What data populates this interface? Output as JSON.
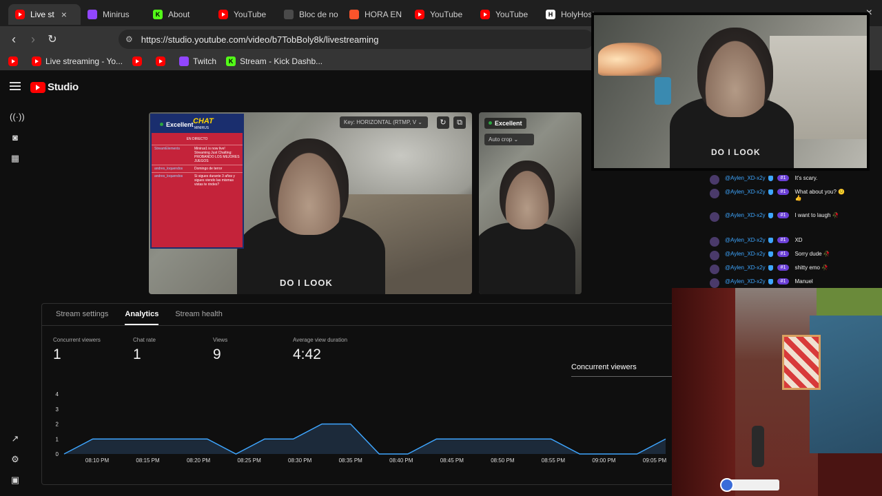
{
  "browser": {
    "tabs": [
      {
        "label": "Live st",
        "icon": "youtube-icon",
        "active": true
      },
      {
        "label": "Minirus",
        "icon": "twitch-icon"
      },
      {
        "label": "About",
        "icon": "kick-icon"
      },
      {
        "label": "YouTube",
        "icon": "youtube-icon"
      },
      {
        "label": "Bloc de no",
        "icon": "notepad-icon"
      },
      {
        "label": "HORA EN",
        "icon": "brave-icon"
      },
      {
        "label": "YouTube",
        "icon": "youtube-icon"
      },
      {
        "label": "YouTube",
        "icon": "youtube-icon"
      },
      {
        "label": "HolyHost",
        "icon": "holyhost-icon"
      }
    ],
    "close_glyph": "×",
    "window_close": "×",
    "url": "https://studio.youtube.com/video/b7TobBoly8k/livestreaming",
    "bookmarks": [
      {
        "label": "",
        "icon": "youtube-icon"
      },
      {
        "label": "Live streaming - Yo...",
        "icon": "youtube-icon"
      },
      {
        "label": "",
        "icon": "youtube-icon"
      },
      {
        "label": "",
        "icon": "youtube-icon"
      },
      {
        "label": "Twitch",
        "icon": "twitch-icon"
      },
      {
        "label": "Stream - Kick Dashb...",
        "icon": "kick-icon"
      }
    ]
  },
  "studio": {
    "logo_text": "Studio",
    "main_preview": {
      "quality": "Excellent",
      "key_label": "Key: HORIZONTAL (RTMP, V",
      "overlay": {
        "title": "CHAT",
        "subtitle": "MINIRUS",
        "live_label": "EN DIRECTO",
        "messages": [
          {
            "user": "StreamElements",
            "text": "Minirus1 is now live! Streaming Just Chatting: PROBANDO LOS MEJORES JUEGOS"
          },
          {
            "user": "andres_loquendos",
            "text": "Domingo de terror"
          },
          {
            "user": "andres_loquendos",
            "text": "Si sigues durante 3 años y sigues viendo las mismas vistas te rindes?"
          }
        ]
      },
      "shirt_text": "DO I LOOK"
    },
    "vertical_preview": {
      "quality": "Excellent",
      "crop_label": "Auto crop"
    },
    "panel": {
      "tabs": [
        "Stream settings",
        "Analytics",
        "Stream health"
      ],
      "active_tab": 1,
      "stats": [
        {
          "label": "Concurrent viewers",
          "value": "1"
        },
        {
          "label": "Chat rate",
          "value": "1"
        },
        {
          "label": "Views",
          "value": "9"
        },
        {
          "label": "Average view duration",
          "value": "4:42"
        }
      ],
      "metric_select": "Concurrent viewers"
    }
  },
  "chat": {
    "messages": [
      {
        "user": "@Aylen_XD-x2y",
        "badge": "#1",
        "text": "It's scary."
      },
      {
        "user": "@Aylen_XD-x2y",
        "badge": "#1",
        "text": "What about you? 😕 👍"
      },
      {
        "user": "@Aylen_XD-x2y",
        "badge": "#1",
        "text": "I want to laugh 🥀"
      },
      {
        "user": "@Aylen_XD-x2y",
        "badge": "#1",
        "text": "XD"
      },
      {
        "user": "@Aylen_XD-x2y",
        "badge": "#1",
        "text": "Sorry dude 🥀"
      },
      {
        "user": "@Aylen_XD-x2y",
        "badge": "#1",
        "text": "shitty emo 🥀"
      },
      {
        "user": "@Aylen_XD-x2y",
        "badge": "#1",
        "text": "Manuel"
      }
    ]
  },
  "chart_data": {
    "type": "area",
    "title": "",
    "series": [
      {
        "values": [
          0,
          1,
          1,
          1,
          1,
          1,
          0,
          1,
          1,
          2,
          2,
          0,
          0,
          1,
          1,
          1,
          1,
          1,
          0,
          0,
          0,
          1
        ]
      }
    ],
    "x_ticks": [
      "08:10 PM",
      "08:15 PM",
      "08:20 PM",
      "08:25 PM",
      "08:30 PM",
      "08:35 PM",
      "08:40 PM",
      "08:45 PM",
      "08:50 PM",
      "08:55 PM",
      "09:00 PM",
      "09:05 PM"
    ],
    "y_ticks": [
      "0",
      "1",
      "2",
      "3",
      "4"
    ],
    "ylim": [
      0,
      4
    ],
    "grid": false,
    "colors": {
      "line": "#3ea6ff",
      "fill": "#1c2a3a"
    }
  }
}
